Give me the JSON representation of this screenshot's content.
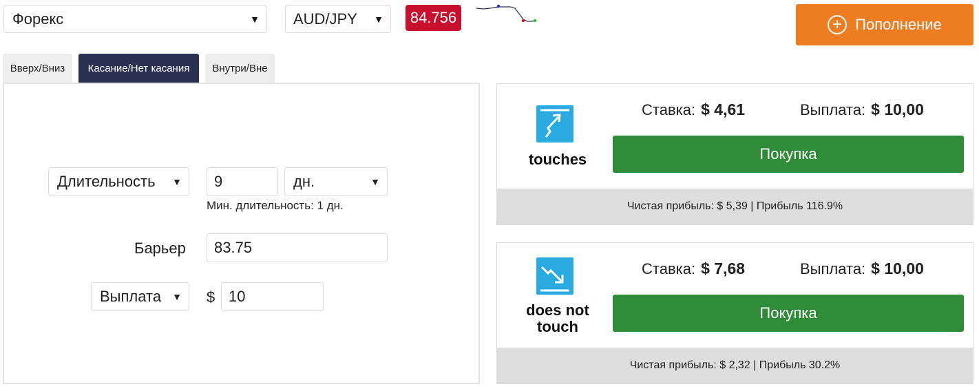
{
  "theme": {
    "spot_bg": "#c8102e",
    "deposit_bg": "#ee7d21",
    "active_tab_bg": "#2a3052",
    "buy_bg": "#2e8b37",
    "icon_bg": "#29abe2",
    "sparkline_color": "#2a3052",
    "sparkline_dots": [
      "#1a2fcc",
      "#d0161b",
      "#2fbf2f"
    ]
  },
  "header": {
    "market_select": {
      "value": "Форекс",
      "icon": "caret-down-icon"
    },
    "asset_select": {
      "value": "AUD/JPY",
      "icon": "caret-down-icon"
    },
    "spot_price": "84.756",
    "deposit_button": {
      "label": "Пополнение",
      "icon": "plus-circle-icon"
    }
  },
  "tabs": [
    {
      "label": "Вверх/Вниз",
      "active": false
    },
    {
      "label": "Касание/Нет касания",
      "active": true
    },
    {
      "label": "Внутри/Вне",
      "active": false
    }
  ],
  "form": {
    "duration_select": {
      "value": "Длительность",
      "icon": "caret-down-icon"
    },
    "duration_value": "9",
    "duration_unit_select": {
      "value": "дн.",
      "icon": "caret-down-icon"
    },
    "min_duration_hint": "Мин. длительность: 1 дн.",
    "barrier_label": "Барьер",
    "barrier_value": "83.75",
    "amount_type_select": {
      "value": "Выплата",
      "icon": "caret-down-icon"
    },
    "currency_symbol": "$",
    "amount_value": "10"
  },
  "contracts": [
    {
      "name": "touches",
      "icon": "touch-arrow-up-icon",
      "stake_label": "Ставка:",
      "stake_value": "$ 4,61",
      "payout_label": "Выплата:",
      "payout_value": "$ 10,00",
      "buy_label": "Покупка",
      "footer": "Чистая прибыль: $ 5,39 | Прибыль 116.9%"
    },
    {
      "name": "does not touch",
      "icon": "no-touch-arrow-down-icon",
      "stake_label": "Ставка:",
      "stake_value": "$ 7,68",
      "payout_label": "Выплата:",
      "payout_value": "$ 10,00",
      "buy_label": "Покупка",
      "footer": "Чистая прибыль: $ 2,32 | Прибыль 30.2%"
    }
  ]
}
